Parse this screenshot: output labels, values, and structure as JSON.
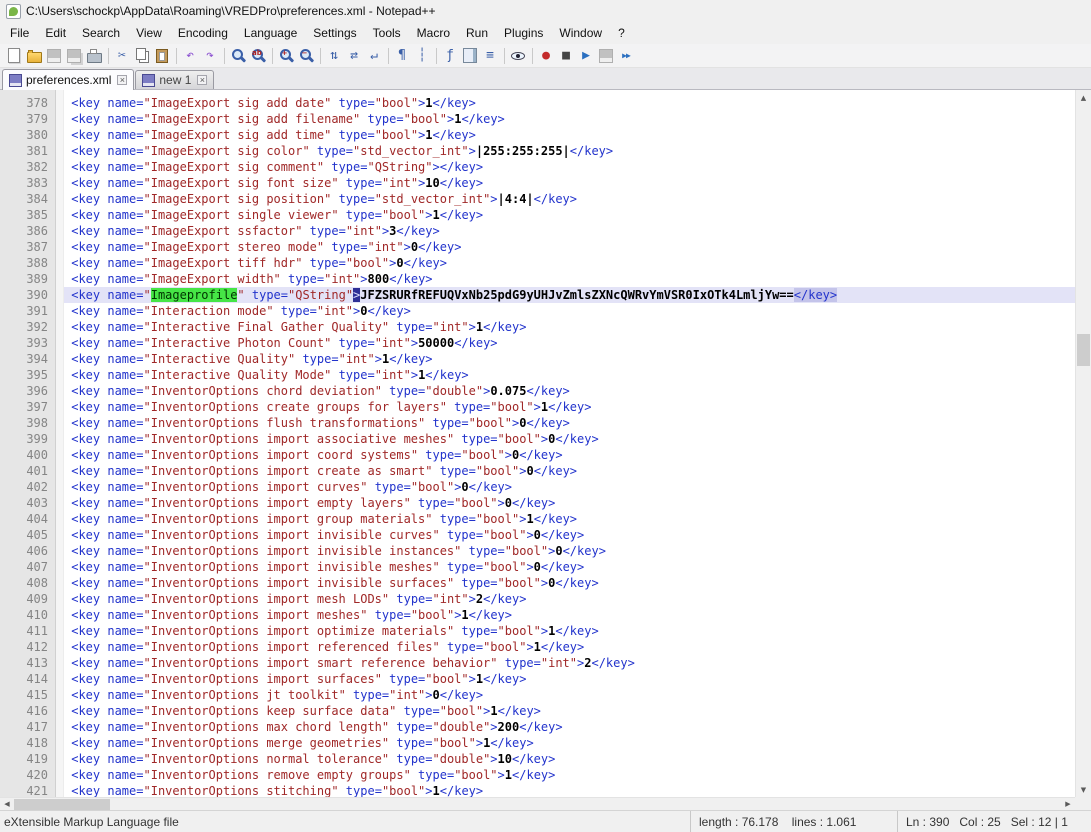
{
  "window": {
    "title": "C:\\Users\\schockp\\AppData\\Roaming\\VREDPro\\preferences.xml - Notepad++"
  },
  "menu": {
    "items": [
      "File",
      "Edit",
      "Search",
      "View",
      "Encoding",
      "Language",
      "Settings",
      "Tools",
      "Macro",
      "Run",
      "Plugins",
      "Window",
      "?"
    ]
  },
  "toolbar": {
    "icons": [
      {
        "name": "new-file-icon",
        "kind": "page"
      },
      {
        "name": "open-file-icon",
        "kind": "folder"
      },
      {
        "name": "save-icon",
        "kind": "floppy",
        "disabled": true
      },
      {
        "name": "save-all-icon",
        "kind": "floppy-all",
        "disabled": true
      },
      {
        "name": "print-icon",
        "kind": "printer"
      },
      {
        "kind": "sep"
      },
      {
        "name": "cut-icon",
        "kind": "glyph",
        "glyph": "✂",
        "color": "#3a5fa8"
      },
      {
        "name": "copy-icon",
        "kind": "copy"
      },
      {
        "name": "paste-icon",
        "kind": "paste"
      },
      {
        "kind": "sep"
      },
      {
        "name": "undo-icon",
        "kind": "glyph",
        "glyph": "↶",
        "color": "#8a4fd0"
      },
      {
        "name": "redo-icon",
        "kind": "glyph",
        "glyph": "↷",
        "color": "#8a4fd0"
      },
      {
        "kind": "sep"
      },
      {
        "name": "find-icon",
        "kind": "mag"
      },
      {
        "name": "replace-icon",
        "kind": "mag",
        "sub": "ab"
      },
      {
        "kind": "sep"
      },
      {
        "name": "zoom-in-icon",
        "kind": "mag",
        "sub": "+"
      },
      {
        "name": "zoom-out-icon",
        "kind": "mag",
        "sub": "−"
      },
      {
        "kind": "sep"
      },
      {
        "name": "sync-vertical-scroll-icon",
        "kind": "glyph",
        "glyph": "⇅",
        "color": "#3a5fa8"
      },
      {
        "name": "sync-horizontal-scroll-icon",
        "kind": "glyph",
        "glyph": "⇄",
        "color": "#3a5fa8"
      },
      {
        "name": "word-wrap-icon",
        "kind": "glyph",
        "glyph": "↵",
        "color": "#3a5fa8"
      },
      {
        "kind": "sep"
      },
      {
        "name": "show-all-characters-icon",
        "kind": "glyph",
        "glyph": "¶",
        "color": "#3a5fa8"
      },
      {
        "name": "indent-guide-icon",
        "kind": "glyph",
        "glyph": "┆",
        "color": "#3a5fa8"
      },
      {
        "kind": "sep"
      },
      {
        "name": "function-list-icon",
        "kind": "glyph",
        "glyph": "ƒ",
        "color": "#3a5fa8"
      },
      {
        "name": "document-map-icon",
        "kind": "docmap"
      },
      {
        "name": "document-list-icon",
        "kind": "glyph",
        "glyph": "≡",
        "color": "#3a5fa8"
      },
      {
        "kind": "sep"
      },
      {
        "name": "monitoring-eye-icon",
        "kind": "eye"
      },
      {
        "kind": "sep"
      },
      {
        "name": "record-macro-icon",
        "kind": "glyph",
        "glyph": "●",
        "color": "#c42b2b"
      },
      {
        "name": "stop-macro-icon",
        "kind": "glyph",
        "glyph": "■",
        "color": "#444444"
      },
      {
        "name": "play-macro-icon",
        "kind": "glyph",
        "glyph": "▶",
        "color": "#2a6fc0"
      },
      {
        "name": "save-macro-icon",
        "kind": "floppy",
        "disabled": true
      },
      {
        "name": "run-macro-multiple-times-icon",
        "kind": "glyph",
        "glyph": "▶▶",
        "color": "#2a6fc0"
      }
    ]
  },
  "tab_bar": {
    "tabs": [
      {
        "label": "preferences.xml",
        "active": true,
        "close_glyph": "×"
      },
      {
        "label": "new 1",
        "active": false,
        "close_glyph": "×"
      }
    ]
  },
  "editor": {
    "lines": [
      {
        "n": 378,
        "name": "ImageExport sig add date",
        "type": "bool",
        "value": "1"
      },
      {
        "n": 379,
        "name": "ImageExport sig add filename",
        "type": "bool",
        "value": "1"
      },
      {
        "n": 380,
        "name": "ImageExport sig add time",
        "type": "bool",
        "value": "1"
      },
      {
        "n": 381,
        "name": "ImageExport sig color",
        "type": "std_vector_int",
        "value": "|255:255:255|"
      },
      {
        "n": 382,
        "name": "ImageExport sig comment",
        "type": "QString",
        "value": ""
      },
      {
        "n": 383,
        "name": "ImageExport sig font size",
        "type": "int",
        "value": "10"
      },
      {
        "n": 384,
        "name": "ImageExport sig position",
        "type": "std_vector_int",
        "value": "|4:4|"
      },
      {
        "n": 385,
        "name": "ImageExport single viewer",
        "type": "bool",
        "value": "1"
      },
      {
        "n": 386,
        "name": "ImageExport ssfactor",
        "type": "int",
        "value": "3"
      },
      {
        "n": 387,
        "name": "ImageExport stereo mode",
        "type": "int",
        "value": "0"
      },
      {
        "n": 388,
        "name": "ImageExport tiff hdr",
        "type": "bool",
        "value": "0"
      },
      {
        "n": 389,
        "name": "ImageExport width",
        "type": "int",
        "value": "800"
      },
      {
        "n": 390,
        "name": "Imageprofile",
        "type": "QString",
        "value": "JFZSRURfREFUQVxNb25pdG9yUHJvZmlsZXNcQWRvYmVSR0IxOTk4LmljYw==",
        "current": true,
        "name_highlighted": true
      },
      {
        "n": 391,
        "name": "Interaction mode",
        "type": "int",
        "value": "0"
      },
      {
        "n": 392,
        "name": "Interactive Final Gather Quality",
        "type": "int",
        "value": "1"
      },
      {
        "n": 393,
        "name": "Interactive Photon Count",
        "type": "int",
        "value": "50000"
      },
      {
        "n": 394,
        "name": "Interactive Quality",
        "type": "int",
        "value": "1"
      },
      {
        "n": 395,
        "name": "Interactive Quality Mode",
        "type": "int",
        "value": "1"
      },
      {
        "n": 396,
        "name": "InventorOptions chord deviation",
        "type": "double",
        "value": "0.075"
      },
      {
        "n": 397,
        "name": "InventorOptions create groups for layers",
        "type": "bool",
        "value": "1"
      },
      {
        "n": 398,
        "name": "InventorOptions flush transformations",
        "type": "bool",
        "value": "0"
      },
      {
        "n": 399,
        "name": "InventorOptions import associative meshes",
        "type": "bool",
        "value": "0"
      },
      {
        "n": 400,
        "name": "InventorOptions import coord systems",
        "type": "bool",
        "value": "0"
      },
      {
        "n": 401,
        "name": "InventorOptions import create as smart",
        "type": "bool",
        "value": "0"
      },
      {
        "n": 402,
        "name": "InventorOptions import curves",
        "type": "bool",
        "value": "0"
      },
      {
        "n": 403,
        "name": "InventorOptions import empty layers",
        "type": "bool",
        "value": "0"
      },
      {
        "n": 404,
        "name": "InventorOptions import group materials",
        "type": "bool",
        "value": "1"
      },
      {
        "n": 405,
        "name": "InventorOptions import invisible curves",
        "type": "bool",
        "value": "0"
      },
      {
        "n": 406,
        "name": "InventorOptions import invisible instances",
        "type": "bool",
        "value": "0"
      },
      {
        "n": 407,
        "name": "InventorOptions import invisible meshes",
        "type": "bool",
        "value": "0"
      },
      {
        "n": 408,
        "name": "InventorOptions import invisible surfaces",
        "type": "bool",
        "value": "0"
      },
      {
        "n": 409,
        "name": "InventorOptions import mesh LODs",
        "type": "int",
        "value": "2"
      },
      {
        "n": 410,
        "name": "InventorOptions import meshes",
        "type": "bool",
        "value": "1"
      },
      {
        "n": 411,
        "name": "InventorOptions import optimize materials",
        "type": "bool",
        "value": "1"
      },
      {
        "n": 412,
        "name": "InventorOptions import referenced files",
        "type": "bool",
        "value": "1"
      },
      {
        "n": 413,
        "name": "InventorOptions import smart reference behavior",
        "type": "int",
        "value": "2"
      },
      {
        "n": 414,
        "name": "InventorOptions import surfaces",
        "type": "bool",
        "value": "1"
      },
      {
        "n": 415,
        "name": "InventorOptions jt toolkit",
        "type": "int",
        "value": "0"
      },
      {
        "n": 416,
        "name": "InventorOptions keep surface data",
        "type": "bool",
        "value": "1"
      },
      {
        "n": 417,
        "name": "InventorOptions max chord length",
        "type": "double",
        "value": "200"
      },
      {
        "n": 418,
        "name": "InventorOptions merge geometries",
        "type": "bool",
        "value": "1"
      },
      {
        "n": 419,
        "name": "InventorOptions normal tolerance",
        "type": "double",
        "value": "10"
      },
      {
        "n": 420,
        "name": "InventorOptions remove empty groups",
        "type": "bool",
        "value": "1"
      },
      {
        "n": 421,
        "name": "InventorOptions stitching",
        "type": "bool",
        "value": "1"
      }
    ]
  },
  "scrollbar": {
    "up_glyph": "▲",
    "down_glyph": "▼",
    "left_glyph": "◀",
    "right_glyph": "▶"
  },
  "status_bar": {
    "doc_type": "eXtensible Markup Language file",
    "length_info": "length : 76.178    lines : 1.061",
    "position_info": "Ln : 390   Col : 25   Sel : 12 | 1"
  },
  "colors": {
    "xml_tag": "#2233cc",
    "xml_string": "#a02828",
    "text_value": "#000000",
    "current_line_bg": "#e3e3f7",
    "smart_highlight_bg": "#46e546",
    "tag_match_bg": "#c4c4ea",
    "chrome_bg": "#f0f0f0"
  }
}
